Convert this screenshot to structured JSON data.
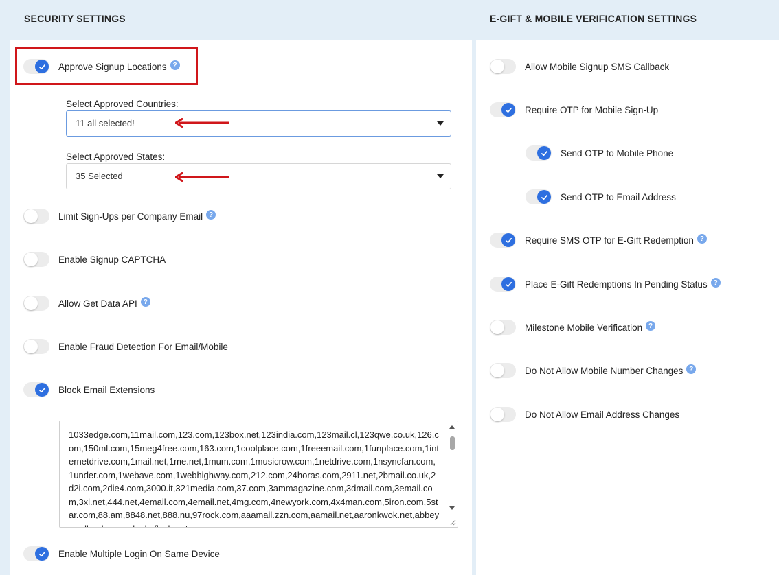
{
  "left_panel": {
    "title": "SECURITY SETTINGS",
    "approve_signup_locations": {
      "label": "Approve Signup Locations",
      "on": true,
      "help": "?"
    },
    "approved_countries": {
      "label": "Select Approved Countries:",
      "value": "11 all selected!"
    },
    "approved_states": {
      "label": "Select Approved States:",
      "value": "35 Selected"
    },
    "limit_signups": {
      "label": "Limit Sign-Ups per Company Email",
      "on": false,
      "help": "?"
    },
    "signup_captcha": {
      "label": "Enable Signup CAPTCHA",
      "on": false
    },
    "get_data_api": {
      "label": "Allow Get Data API",
      "on": false,
      "help": "?"
    },
    "fraud_detection": {
      "label": "Enable Fraud Detection For Email/Mobile",
      "on": false
    },
    "block_email_extensions": {
      "label": "Block Email Extensions",
      "on": true
    },
    "blocked_domains_text": "1033edge.com,11mail.com,123.com,123box.net,123india.com,123mail.cl,123qwe.co.uk,126.com,150ml.com,15meg4free.com,163.com,1coolplace.com,1freeemail.com,1funplace.com,1internetdrive.com,1mail.net,1me.net,1mum.com,1musicrow.com,1netdrive.com,1nsyncfan.com,1under.com,1webave.com,1webhighway.com,212.com,24horas.com,2911.net,2bmail.co.uk,2d2i.com,2die4.com,3000.it,321media.com,37.com,3ammagazine.com,3dmail.com,3email.com,3xl.net,444.net,4email.com,4email.net,4mg.com,4newyork.com,4x4man.com,5iron.com,5star.com,88.am,8848.net,888.nu,97rock.com,aaamail.zzn.com,aamail.net,aaronkwok.net,abbeyroadlondon.co.uk,abcflash.net",
    "multiple_login": {
      "label": "Enable Multiple Login On Same Device",
      "on": true
    }
  },
  "right_panel": {
    "title": "E-GIFT & MOBILE VERIFICATION SETTINGS",
    "sms_callback": {
      "label": "Allow Mobile Signup SMS Callback",
      "on": false
    },
    "require_otp": {
      "label": "Require OTP for Mobile Sign-Up",
      "on": true
    },
    "otp_phone": {
      "label": "Send OTP to Mobile Phone",
      "on": true
    },
    "otp_email": {
      "label": "Send OTP to Email Address",
      "on": true
    },
    "sms_otp_egift": {
      "label": "Require SMS OTP for E-Gift Redemption",
      "on": true,
      "help": "?"
    },
    "pending_status": {
      "label": "Place E-Gift Redemptions In Pending Status",
      "on": true,
      "help": "?"
    },
    "milestone_verification": {
      "label": "Milestone Mobile Verification",
      "on": false,
      "help": "?"
    },
    "no_mobile_change": {
      "label": "Do Not Allow Mobile Number Changes",
      "on": false,
      "help": "?"
    },
    "no_email_change": {
      "label": "Do Not Allow Email Address Changes",
      "on": false
    }
  },
  "colors": {
    "toggle_on": "#2e6fe0",
    "help_icon": "#78a8ec",
    "highlight": "#d0161a",
    "header_bg": "#e3eef7"
  }
}
